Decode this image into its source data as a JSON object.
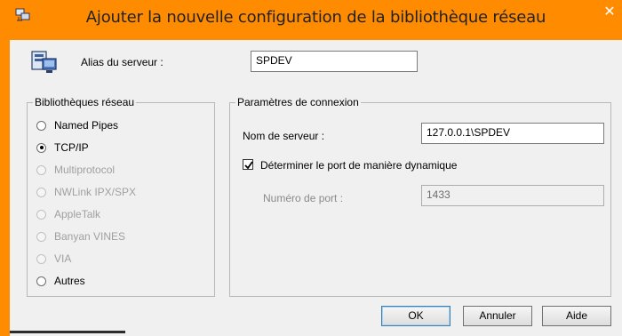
{
  "window": {
    "title": "Ajouter la nouvelle configuration de la bibliothèque réseau",
    "title_icon": "network-config-icon",
    "close_icon": "close-icon"
  },
  "alias": {
    "label": "Alias du serveur :",
    "value": "SPDEV",
    "icon": "server-alias-icon"
  },
  "libraries": {
    "legend": "Bibliothèques réseau",
    "options": [
      {
        "label": "Named Pipes",
        "checked": false,
        "enabled": true
      },
      {
        "label": "TCP/IP",
        "checked": true,
        "enabled": true
      },
      {
        "label": "Multiprotocol",
        "checked": false,
        "enabled": false
      },
      {
        "label": "NWLink IPX/SPX",
        "checked": false,
        "enabled": false
      },
      {
        "label": "AppleTalk",
        "checked": false,
        "enabled": false
      },
      {
        "label": "Banyan VINES",
        "checked": false,
        "enabled": false
      },
      {
        "label": "VIA",
        "checked": false,
        "enabled": false
      },
      {
        "label": "Autres",
        "checked": false,
        "enabled": true
      }
    ]
  },
  "connection": {
    "legend": "Paramètres de connexion",
    "server_label": "Nom de serveur :",
    "server_value": "127.0.0.1\\SPDEV",
    "dynamic_port_label": "Déterminer le port de manière dynamique",
    "dynamic_port_checked": true,
    "port_label": "Numéro de port :",
    "port_value": "1433"
  },
  "buttons": {
    "ok": "OK",
    "cancel": "Annuler",
    "help": "Aide"
  }
}
